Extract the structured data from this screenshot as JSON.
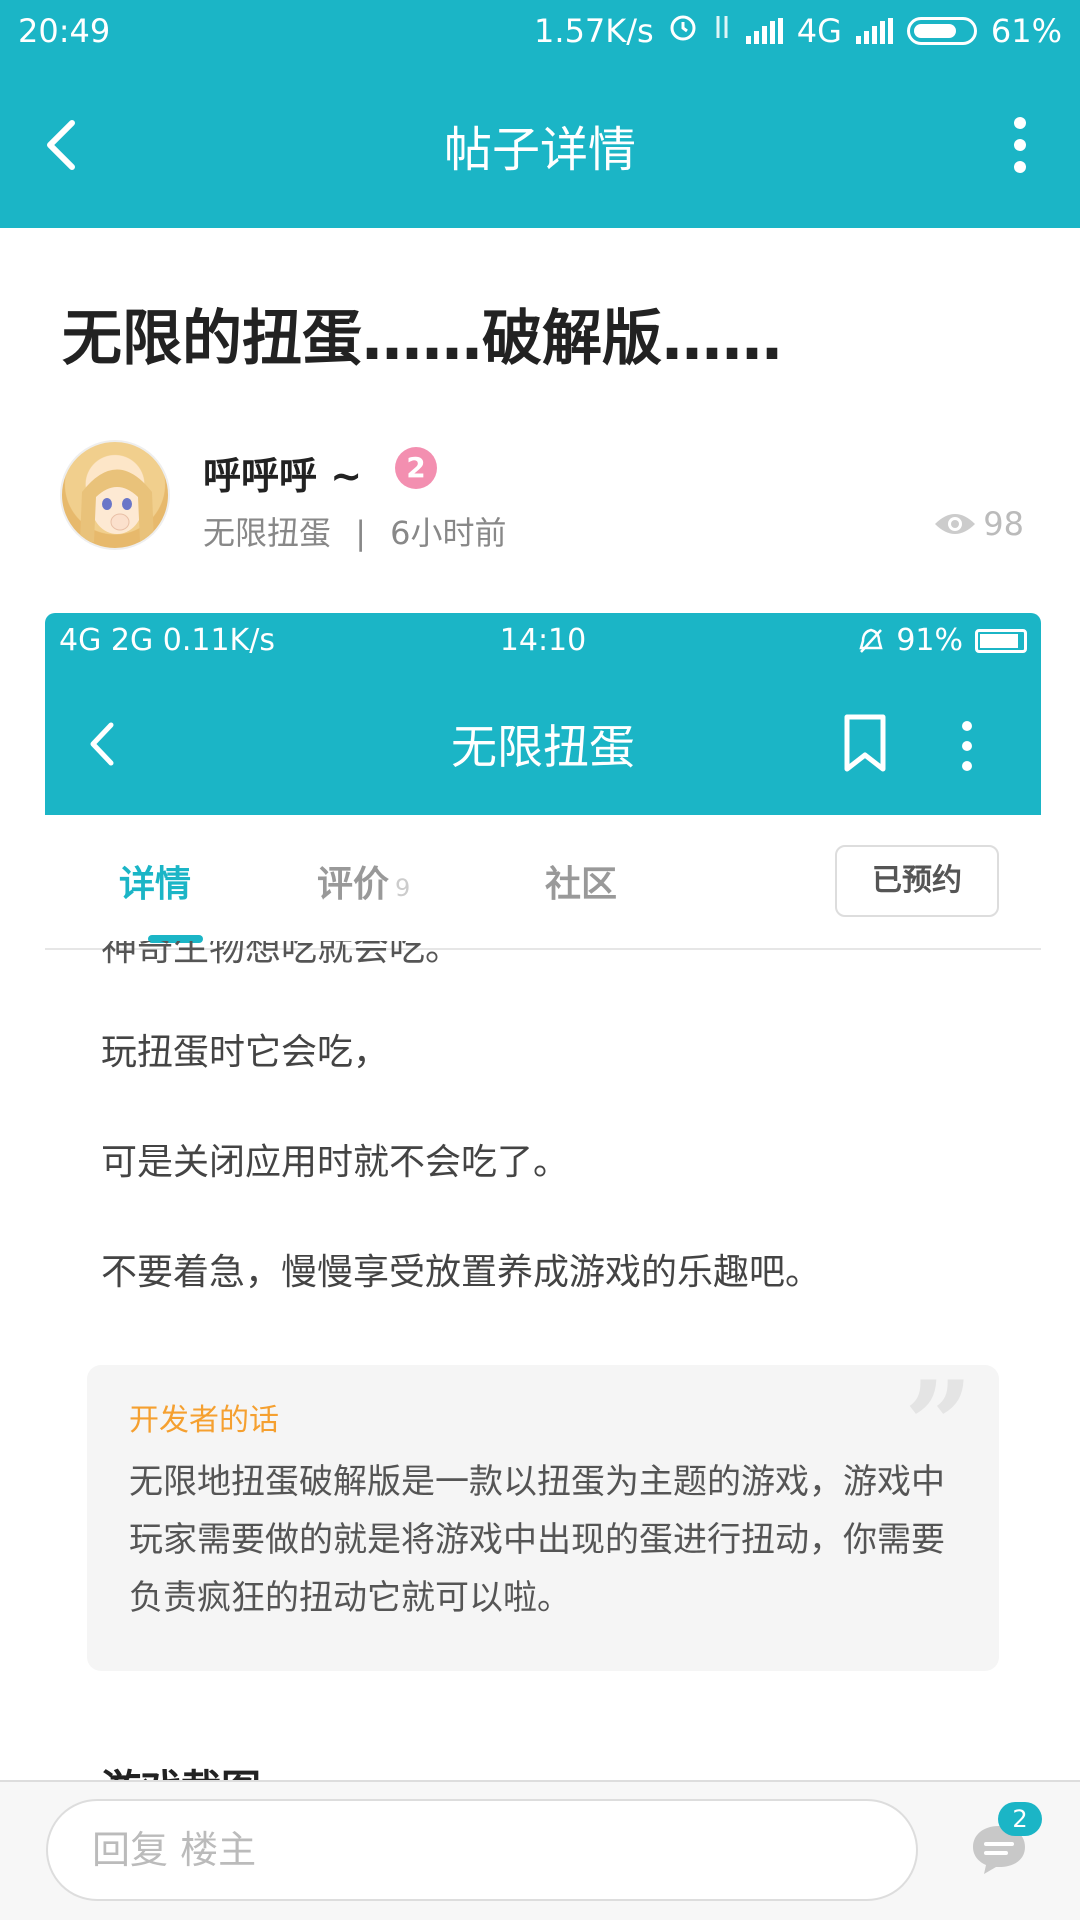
{
  "status_bar": {
    "time": "20:49",
    "speed": "1.57K/s",
    "network": "4G",
    "battery": "61%"
  },
  "header": {
    "title": "帖子详情"
  },
  "post": {
    "title": "无限的扭蛋……破解版……",
    "author": "呼呼呼 ~",
    "level": "2",
    "forum": "无限扭蛋",
    "separator": "|",
    "time_ago": "6小时前",
    "views": "98"
  },
  "embedded": {
    "status": {
      "left": "4G 2G 0.11K/s",
      "time": "14:10",
      "battery": "91%"
    },
    "header_title": "无限扭蛋",
    "tabs": [
      {
        "label": "详情"
      },
      {
        "label": "评价",
        "count": "9"
      },
      {
        "label": "社区"
      }
    ],
    "reserved_label": "已预约",
    "cut_line": "神奇生物想吃就会吃。",
    "paragraphs": [
      "玩扭蛋时它会吃，",
      "可是关闭应用时就不会吃了。",
      "不要着急，慢慢享受放置养成游戏的乐趣吧。"
    ],
    "developer": {
      "label": "开发者的话",
      "text": "无限地扭蛋破解版是一款以扭蛋为主题的游戏，游戏中玩家需要做的就是将游戏中出现的蛋进行扭动，你需要负责疯狂的扭动它就可以啦。"
    },
    "section_title": "游戏截图"
  },
  "reply": {
    "placeholder": "回复  楼主",
    "comment_count": "2"
  },
  "colors": {
    "brand": "#1bb5c6",
    "accent_orange": "#f5a030",
    "badge_pink": "#f38fb0"
  }
}
